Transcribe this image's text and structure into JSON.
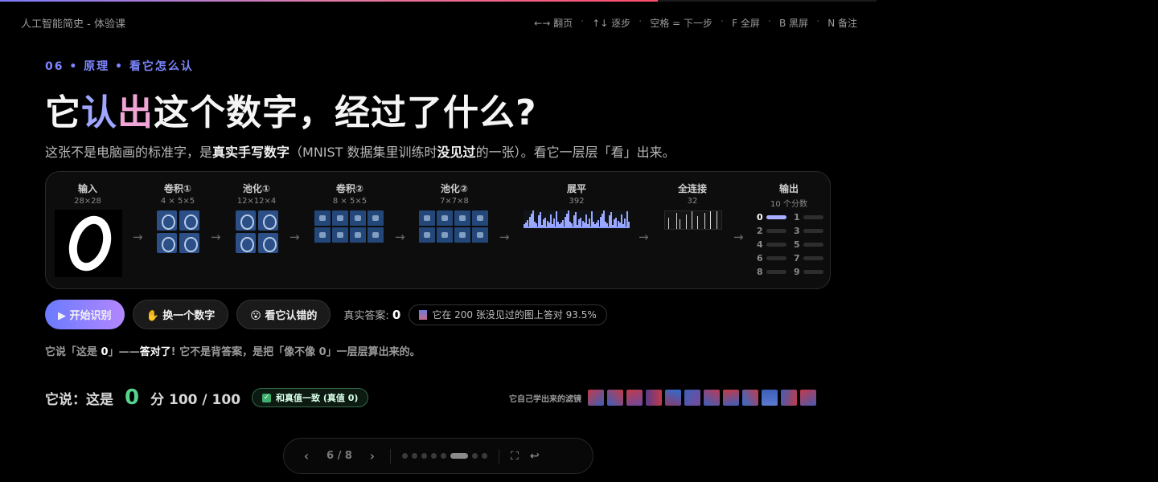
{
  "progress_percent": 75,
  "header": {
    "course_title": "人工智能简史 - 体验课",
    "hints": [
      "←→ 翻页",
      "↑↓ 逐步",
      "空格 = 下一步",
      "F 全屏",
      "B 黑屏",
      "N 备注"
    ],
    "separator": "·"
  },
  "slide": {
    "kicker": "06 • 原理 • 看它怎么认",
    "title_a": "它",
    "title_b": "认",
    "title_c": "出",
    "title_d": "这个数字，经过了什么?",
    "subtitle_1": "这张不是电脑画的标准字，是",
    "subtitle_bold_1": "真实手写数字",
    "subtitle_2": "（MNIST 数据集里训练时",
    "subtitle_bold_2": "没见过",
    "subtitle_3": "的一张）。看它一层层「看」出来。"
  },
  "pipeline": {
    "stages": [
      {
        "label": "输入",
        "dim": "28×28"
      },
      {
        "label": "卷积①",
        "dim": "4 × 5×5"
      },
      {
        "label": "池化①",
        "dim": "12×12×4"
      },
      {
        "label": "卷积②",
        "dim": "8 × 5×5"
      },
      {
        "label": "池化②",
        "dim": "7×7×8"
      },
      {
        "label": "展平",
        "dim": "392"
      },
      {
        "label": "全连接",
        "dim": "32"
      },
      {
        "label": "输出",
        "dim": "10 个分数"
      }
    ],
    "arrow": "→",
    "outputs": [
      {
        "digit": "0",
        "score": 1.0
      },
      {
        "digit": "1",
        "score": 0.0
      },
      {
        "digit": "2",
        "score": 0.0
      },
      {
        "digit": "3",
        "score": 0.0
      },
      {
        "digit": "4",
        "score": 0.0
      },
      {
        "digit": "5",
        "score": 0.0
      },
      {
        "digit": "6",
        "score": 0.0
      },
      {
        "digit": "7",
        "score": 0.0
      },
      {
        "digit": "8",
        "score": 0.0
      },
      {
        "digit": "9",
        "score": 0.0
      }
    ]
  },
  "controls": {
    "start_label": "▶ 开始识别",
    "swap_label": "✋ 换一个数字",
    "errors_label": "😮 看它认错的",
    "truth_label": "真实答案:",
    "truth_value": "0",
    "accuracy_text": "它在 200 张没见过的图上答对 93.5%"
  },
  "verdict": {
    "p1": "它说「这是 ",
    "digit": "0",
    "p2": "」——",
    "bold": "答对了",
    "p3": "! 它不是背答案，是把「像不像 0」一层层算出来的。"
  },
  "result": {
    "prefix": "它说：这是",
    "digit": "0",
    "score_label": "分 100 / 100",
    "match_label": "和真值一致 (真值 0)",
    "filters_label": "它自己学出来的滤镜"
  },
  "colors": {
    "accent": "#7d86ff",
    "pink": "#f0a5d6",
    "green": "#56d38c"
  },
  "pager": {
    "prev": "‹",
    "next": "›",
    "count": "6 / 8",
    "total_slides": 8,
    "current_slide": 6,
    "fullscreen_icon": "fullscreen-icon",
    "return_icon": "return-icon"
  }
}
